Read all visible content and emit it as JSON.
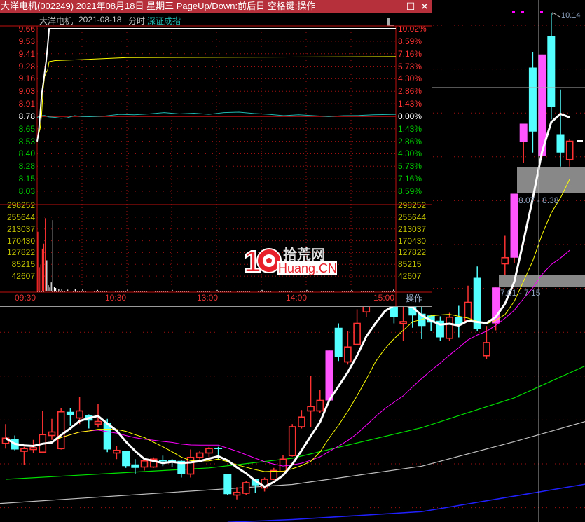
{
  "window": {
    "title": "大洋电机(002249) 2021年08月18日 星期三 PageUp/Down:前后日 空格键:操作",
    "maximize_icon": "maximize-icon",
    "close_icon": "close-icon"
  },
  "intraday": {
    "stock_name": "大洋电机",
    "date": "2021-08-18",
    "mode": "分时",
    "index_name": "深证成指",
    "toggle_icon": "panel-toggle-icon",
    "prev_close": 8.78,
    "price_labels": [
      "9.66",
      "9.53",
      "9.41",
      "9.28",
      "9.16",
      "9.03",
      "8.91",
      "8.78",
      "8.65",
      "8.53",
      "8.40",
      "8.28",
      "8.15",
      "8.03"
    ],
    "pct_labels": [
      "10.02%",
      "8.59%",
      "7.16%",
      "5.73%",
      "4.30%",
      "2.86%",
      "1.43%",
      "0.00%",
      "1.43%",
      "2.86%",
      "4.30%",
      "5.73%",
      "7.16%",
      "8.59%"
    ],
    "volume_labels": [
      "298252",
      "255644",
      "213037",
      "170430",
      "127822",
      "85215",
      "42607"
    ],
    "volume_max": 298252,
    "time_labels": [
      "09:30",
      "10:30",
      "13:00",
      "14:00",
      "15:00"
    ],
    "operate_button": "操作",
    "price_series": [
      [
        0,
        8.53
      ],
      [
        1,
        8.62
      ],
      [
        2,
        8.8
      ],
      [
        3,
        9.0
      ],
      [
        4,
        9.1
      ],
      [
        5,
        9.22
      ],
      [
        6,
        9.33
      ],
      [
        7,
        9.48
      ],
      [
        8,
        9.66
      ],
      [
        240,
        9.66
      ]
    ],
    "avg_series": [
      [
        0,
        8.53
      ],
      [
        1,
        8.6
      ],
      [
        2,
        8.66
      ],
      [
        3,
        8.8
      ],
      [
        4,
        9.05
      ],
      [
        5,
        9.18
      ],
      [
        6,
        9.22
      ],
      [
        7,
        9.24
      ],
      [
        8,
        9.33
      ],
      [
        12,
        9.34
      ],
      [
        30,
        9.35
      ],
      [
        60,
        9.37
      ],
      [
        240,
        9.38
      ]
    ],
    "index_series_pct": [
      [
        0,
        -0.1
      ],
      [
        3,
        0.1
      ],
      [
        5,
        0.12
      ],
      [
        8,
        -0.05
      ],
      [
        12,
        -0.1
      ],
      [
        16,
        -0.2
      ],
      [
        20,
        -0.15
      ],
      [
        25,
        0.1
      ],
      [
        30,
        0.0
      ],
      [
        35,
        -0.02
      ],
      [
        45,
        0.05
      ],
      [
        55,
        0.25
      ],
      [
        65,
        0.2
      ],
      [
        75,
        0.3
      ],
      [
        85,
        0.45
      ],
      [
        95,
        0.3
      ],
      [
        105,
        0.38
      ],
      [
        115,
        0.25
      ],
      [
        125,
        0.45
      ],
      [
        135,
        0.5
      ],
      [
        145,
        0.35
      ],
      [
        155,
        0.25
      ],
      [
        165,
        0.1
      ],
      [
        175,
        0.2
      ],
      [
        185,
        0.1
      ],
      [
        195,
        0.0
      ],
      [
        205,
        0.1
      ],
      [
        215,
        0.12
      ],
      [
        225,
        0.2
      ],
      [
        240,
        0.25
      ]
    ],
    "volume_series": [
      [
        0,
        213000,
        "up"
      ],
      [
        1,
        85000,
        "up"
      ],
      [
        2,
        95000,
        "up"
      ],
      [
        3,
        152000,
        "up"
      ],
      [
        4,
        170000,
        "up"
      ],
      [
        5,
        262000,
        "up"
      ],
      [
        6,
        110000,
        "down"
      ],
      [
        7,
        20000,
        "down"
      ],
      [
        8,
        12000,
        "down"
      ],
      [
        9,
        30000,
        "down"
      ],
      [
        10,
        255000,
        "down"
      ],
      [
        11,
        15000,
        "down"
      ],
      [
        12,
        10000,
        "down"
      ],
      [
        14,
        6000,
        "down"
      ],
      [
        16,
        5000,
        "down"
      ],
      [
        20,
        4000,
        "down"
      ],
      [
        25,
        5000,
        "down"
      ],
      [
        30,
        5000,
        "down"
      ],
      [
        40,
        3000,
        "down"
      ],
      [
        60,
        4000,
        "down"
      ],
      [
        90,
        3000,
        "down"
      ],
      [
        120,
        3000,
        "down"
      ],
      [
        150,
        3000,
        "down"
      ],
      [
        180,
        3000,
        "down"
      ],
      [
        210,
        3000,
        "down"
      ],
      [
        238,
        4000,
        "down"
      ]
    ]
  },
  "logo": {
    "number": "10",
    "cn": "拾荒网",
    "en": "Huang.CN"
  },
  "kline": {
    "high_label": "10.14",
    "range_upper": "8.07 - 8.38",
    "range_lower": "7.01 - 7.15",
    "colors": {
      "up": "#ff3232",
      "down": "#54ffff",
      "limit": "#ff55ff",
      "ma5": "#ffffff",
      "ma10": "#ffff00",
      "ma20": "#ff00ff",
      "ma60": "#00e000",
      "ma120": "#c0c0c0",
      "ma250": "#2020ff"
    },
    "candles": [
      [
        5.23,
        5.29,
        5.45,
        5.17
      ],
      [
        5.28,
        5.16,
        5.32,
        5.15
      ],
      [
        5.14,
        5.17,
        5.19,
        4.98
      ],
      [
        5.16,
        5.18,
        5.27,
        5.12
      ],
      [
        5.13,
        5.33,
        5.6,
        5.12
      ],
      [
        5.32,
        5.36,
        5.51,
        5.27
      ],
      [
        5.17,
        5.59,
        5.63,
        5.16
      ],
      [
        5.59,
        5.55,
        5.63,
        5.43
      ],
      [
        5.52,
        5.6,
        5.76,
        5.45
      ],
      [
        5.55,
        5.49,
        5.56,
        5.4
      ],
      [
        5.45,
        5.48,
        5.68,
        5.41
      ],
      [
        5.46,
        5.16,
        5.51,
        5.13
      ],
      [
        5.12,
        5.15,
        5.2,
        5.05
      ],
      [
        5.14,
        4.97,
        5.14,
        4.95
      ],
      [
        4.99,
        4.95,
        5.05,
        4.88
      ],
      [
        4.96,
        5.03,
        5.04,
        4.92
      ],
      [
        4.96,
        5.05,
        5.07,
        4.95
      ],
      [
        5.04,
        5.03,
        5.09,
        4.97
      ],
      [
        5.04,
        5.035,
        5.05,
        4.96
      ],
      [
        5.03,
        4.88,
        5.04,
        4.84
      ],
      [
        4.88,
        5.07,
        5.16,
        4.84
      ],
      [
        5.07,
        5.12,
        5.14,
        5.04
      ],
      [
        5.12,
        5.17,
        5.19,
        5.07
      ],
      [
        5.18,
        5.17,
        5.19,
        5.04
      ],
      [
        4.88,
        4.65,
        4.88,
        4.64
      ],
      [
        4.64,
        4.67,
        4.73,
        4.59
      ],
      [
        4.66,
        4.78,
        4.8,
        4.64
      ],
      [
        4.82,
        4.75,
        4.82,
        4.66
      ],
      [
        4.72,
        4.82,
        4.84,
        4.68
      ],
      [
        4.82,
        4.92,
        4.95,
        4.81
      ],
      [
        4.91,
        5.05,
        5.1,
        4.9
      ],
      [
        5.09,
        5.42,
        5.45,
        5.08
      ],
      [
        5.42,
        5.53,
        5.61,
        5.4
      ],
      [
        5.6,
        5.65,
        6.0,
        5.42
      ],
      [
        5.6,
        5.72,
        5.84,
        5.58
      ],
      [
        5.72,
        6.29,
        6.29,
        5.72,
        "limit"
      ],
      [
        6.55,
        6.22,
        6.6,
        6.17
      ],
      [
        6.16,
        6.33,
        6.51,
        6.13
      ],
      [
        6.36,
        6.6,
        6.76,
        6.35
      ],
      [
        6.73,
        6.81,
        6.95,
        6.67
      ],
      [
        6.85,
        7.05,
        7.12,
        6.8
      ],
      [
        7.1,
        6.9,
        7.15,
        6.85
      ],
      [
        6.81,
        6.67,
        6.82,
        6.6
      ],
      [
        6.6,
        6.62,
        6.8,
        6.4
      ],
      [
        6.81,
        6.69,
        6.85,
        6.55
      ],
      [
        6.71,
        6.57,
        6.79,
        6.42
      ],
      [
        6.69,
        6.61,
        6.7,
        6.51
      ],
      [
        6.63,
        6.44,
        6.68,
        6.4
      ],
      [
        6.43,
        6.67,
        6.72,
        6.4
      ],
      [
        6.67,
        6.59,
        6.8,
        6.44
      ],
      [
        6.63,
        6.84,
        7.03,
        6.62
      ],
      [
        7.12,
        6.54,
        7.25,
        6.51
      ],
      [
        6.23,
        6.38,
        6.57,
        6.19
      ],
      [
        6.6,
        7.01,
        7.01,
        6.52,
        "limit"
      ],
      [
        7.28,
        7.35,
        7.6,
        7.15
      ],
      [
        7.35,
        8.08,
        8.08,
        7.29,
        "limit"
      ],
      [
        8.67,
        8.88,
        8.88,
        8.43,
        "limit"
      ],
      [
        9.52,
        8.79,
        9.7,
        8.55
      ],
      [
        8.51,
        9.67,
        9.67,
        8.51,
        "limit"
      ],
      [
        9.88,
        9.07,
        10.14,
        8.93
      ],
      [
        8.76,
        8.55,
        9.27,
        8.39
      ],
      [
        8.47,
        8.68,
        8.7,
        8.39
      ]
    ],
    "ma60_points": [
      [
        0,
        4.82
      ],
      [
        22,
        4.95
      ],
      [
        31,
        5.06
      ],
      [
        45,
        5.41
      ],
      [
        55,
        5.75
      ],
      [
        63,
        6.13
      ]
    ],
    "ma120_points": [
      [
        -1,
        4.54
      ],
      [
        31,
        4.76
      ],
      [
        45,
        4.97
      ],
      [
        55,
        5.25
      ],
      [
        63,
        5.49
      ]
    ],
    "ma250_points": [
      [
        24,
        4.33
      ],
      [
        31,
        4.36
      ],
      [
        45,
        4.45
      ],
      [
        63,
        4.77
      ]
    ]
  }
}
